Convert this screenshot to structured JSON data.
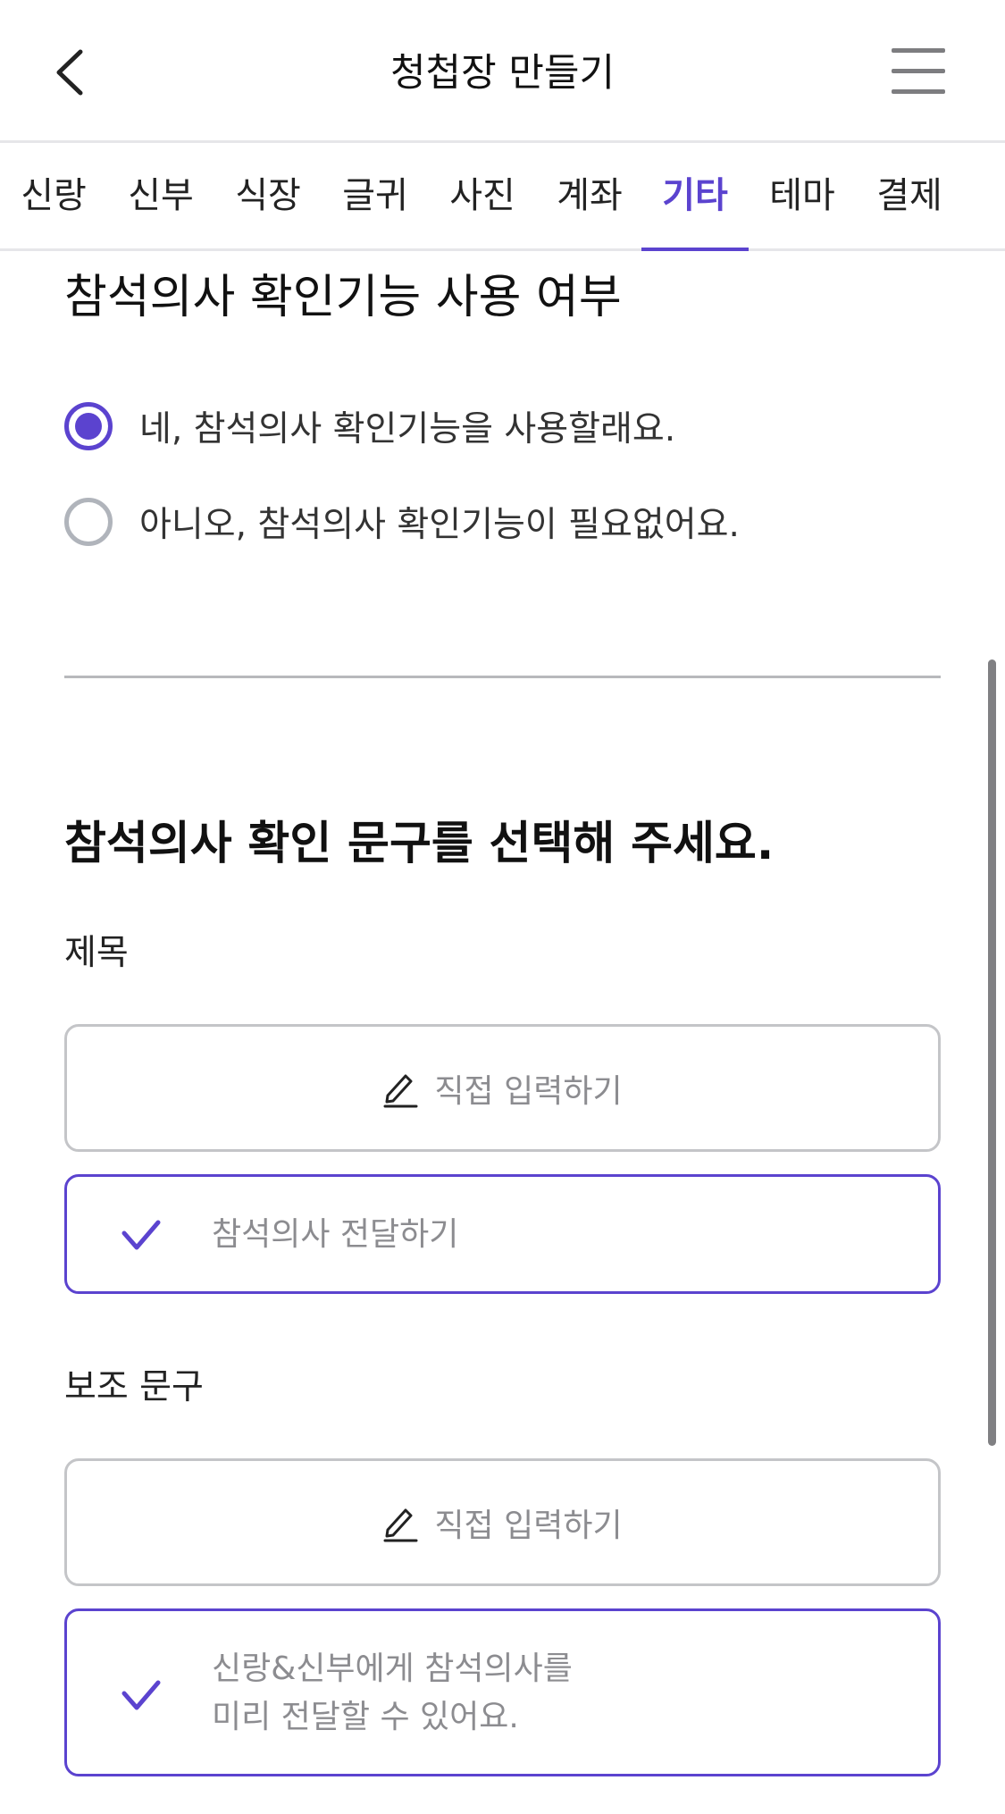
{
  "header": {
    "title": "청첩장 만들기",
    "back_icon": "chevron-left-icon",
    "menu_icon": "hamburger-menu-icon"
  },
  "tabs": [
    {
      "label": "신랑",
      "active": false
    },
    {
      "label": "신부",
      "active": false
    },
    {
      "label": "식장",
      "active": false
    },
    {
      "label": "글귀",
      "active": false
    },
    {
      "label": "사진",
      "active": false
    },
    {
      "label": "계좌",
      "active": false
    },
    {
      "label": "기타",
      "active": true
    },
    {
      "label": "테마",
      "active": false
    },
    {
      "label": "결제",
      "active": false
    }
  ],
  "rsvp_toggle": {
    "title": "참석의사 확인기능 사용 여부",
    "options": [
      {
        "label": "네, 참석의사 확인기능을 사용할래요.",
        "selected": true
      },
      {
        "label": "아니오, 참석의사 확인기능이 필요없어요.",
        "selected": false
      }
    ]
  },
  "phrase_section": {
    "heading": "참석의사 확인 문구를 선택해 주세요.",
    "title_field": {
      "label": "제목",
      "direct_input_label": "직접 입력하기",
      "selected_text": "참석의사 전달하기"
    },
    "sub_field": {
      "label": "보조 문구",
      "direct_input_label": "직접 입력하기",
      "selected_text_line1": "신랑&신부에게 참석의사를",
      "selected_text_line2": "미리 전달할 수 있어요."
    }
  },
  "colors": {
    "accent": "#5b43cf",
    "border": "#c4c5c8",
    "muted_text": "#8c8c90"
  }
}
